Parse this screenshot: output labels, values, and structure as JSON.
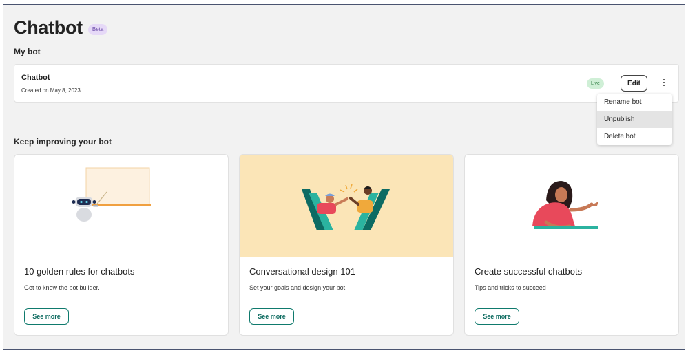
{
  "header": {
    "title": "Chatbot",
    "badge": "Beta"
  },
  "my_bot": {
    "section_label": "My bot",
    "bot": {
      "name": "Chatbot",
      "created": "Created on May 8, 2023",
      "status": "Live",
      "edit_label": "Edit",
      "more_icon": "more-vertical-icon"
    },
    "menu": [
      {
        "label": "Rename bot"
      },
      {
        "label": "Unpublish",
        "hovered": true
      },
      {
        "label": "Delete bot"
      }
    ]
  },
  "improve": {
    "section_label": "Keep improving your bot",
    "cards": [
      {
        "title": "10 golden rules for chatbots",
        "description": "Get to know the bot builder.",
        "button": "See more",
        "illustration": "robot-presenter-illustration"
      },
      {
        "title": "Conversational design 101",
        "description": "Set your goals and design your bot",
        "button": "See more",
        "illustration": "high-five-illustration"
      },
      {
        "title": "Create successful chatbots",
        "description": "Tips and tricks to succeed",
        "button": "See more",
        "illustration": "woman-at-desk-illustration"
      }
    ]
  },
  "colors": {
    "background": "#f2f2f2",
    "accent": "#0f7a6d",
    "beta_bg": "#e6d9f7",
    "live_bg": "#cfefd6",
    "card2_art_bg": "#fbe5b7"
  }
}
